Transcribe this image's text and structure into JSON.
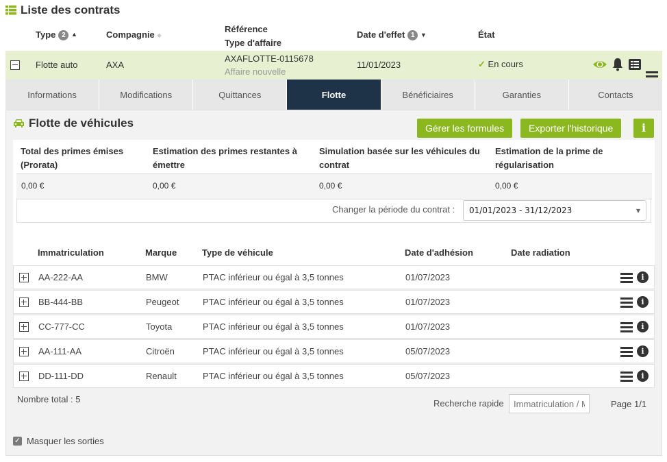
{
  "page": {
    "title": "Liste des contrats"
  },
  "contracts_header": {
    "type": "Type",
    "type_badge": "2",
    "compagnie": "Compagnie",
    "reference": "Référence",
    "type_affaire": "Type d'affaire",
    "date_effet": "Date d'effet",
    "date_badge": "1",
    "etat": "État"
  },
  "contract": {
    "type": "Flotte auto",
    "compagnie": "AXA",
    "reference": "AXAFLOTTE-0115678",
    "type_affaire": "Affaire nouvelle",
    "date_effet": "11/01/2023",
    "etat": "En cours"
  },
  "tabs": [
    {
      "label": "Informations"
    },
    {
      "label": "Modifications"
    },
    {
      "label": "Quittances"
    },
    {
      "label": "Flotte",
      "active": true
    },
    {
      "label": "Bénéficiaires"
    },
    {
      "label": "Garanties"
    },
    {
      "label": "Contacts"
    }
  ],
  "flotte": {
    "title": "Flotte de véhicules",
    "btn_formules": "Gérer les formules",
    "btn_export": "Exporter l'historique",
    "btn_info": "i",
    "summary_headers": [
      "Total des primes émises (Prorata)",
      "Estimation des primes restantes à émettre",
      "Simulation basée sur les véhicules du contrat",
      "Estimation de la prime de régularisation"
    ],
    "summary_values": [
      "0,00 €",
      "0,00 €",
      "0,00 €",
      "0,00 €"
    ],
    "period_label": "Changer la période du contrat :",
    "period_value": "01/01/2023 - 31/12/2023"
  },
  "vehicles": {
    "headers": [
      "Immatriculation",
      "Marque",
      "Type de véhicule",
      "Date d'adhésion",
      "Date radiation"
    ],
    "rows": [
      {
        "immat": "AA-222-AA",
        "marque": "BMW",
        "type": "PTAC inférieur ou égal à 3,5 tonnes",
        "adhesion": "01/07/2023",
        "radiation": ""
      },
      {
        "immat": "BB-444-BB",
        "marque": "Peugeot",
        "type": "PTAC inférieur ou égal à 3,5 tonnes",
        "adhesion": "01/07/2023",
        "radiation": ""
      },
      {
        "immat": "CC-777-CC",
        "marque": "Toyota",
        "type": "PTAC inférieur ou égal à 3,5 tonnes",
        "adhesion": "01/07/2023",
        "radiation": ""
      },
      {
        "immat": "AA-111-AA",
        "marque": "Citroën",
        "type": "PTAC inférieur ou égal à 3,5 tonnes",
        "adhesion": "05/07/2023",
        "radiation": ""
      },
      {
        "immat": "DD-111-DD",
        "marque": "Renault",
        "type": "PTAC inférieur ou égal à 3,5 tonnes",
        "adhesion": "05/07/2023",
        "radiation": ""
      }
    ],
    "total": "Nombre total : 5",
    "search_label": "Recherche rapide",
    "search_placeholder": "Immatriculation / Marque",
    "page": "Page 1/1"
  },
  "footer": {
    "hide_exits": "Masquer les sorties"
  },
  "colors": {
    "accent": "#8ab81e",
    "tab_active": "#1e3347",
    "row_highlight": "#e8f0d2"
  }
}
